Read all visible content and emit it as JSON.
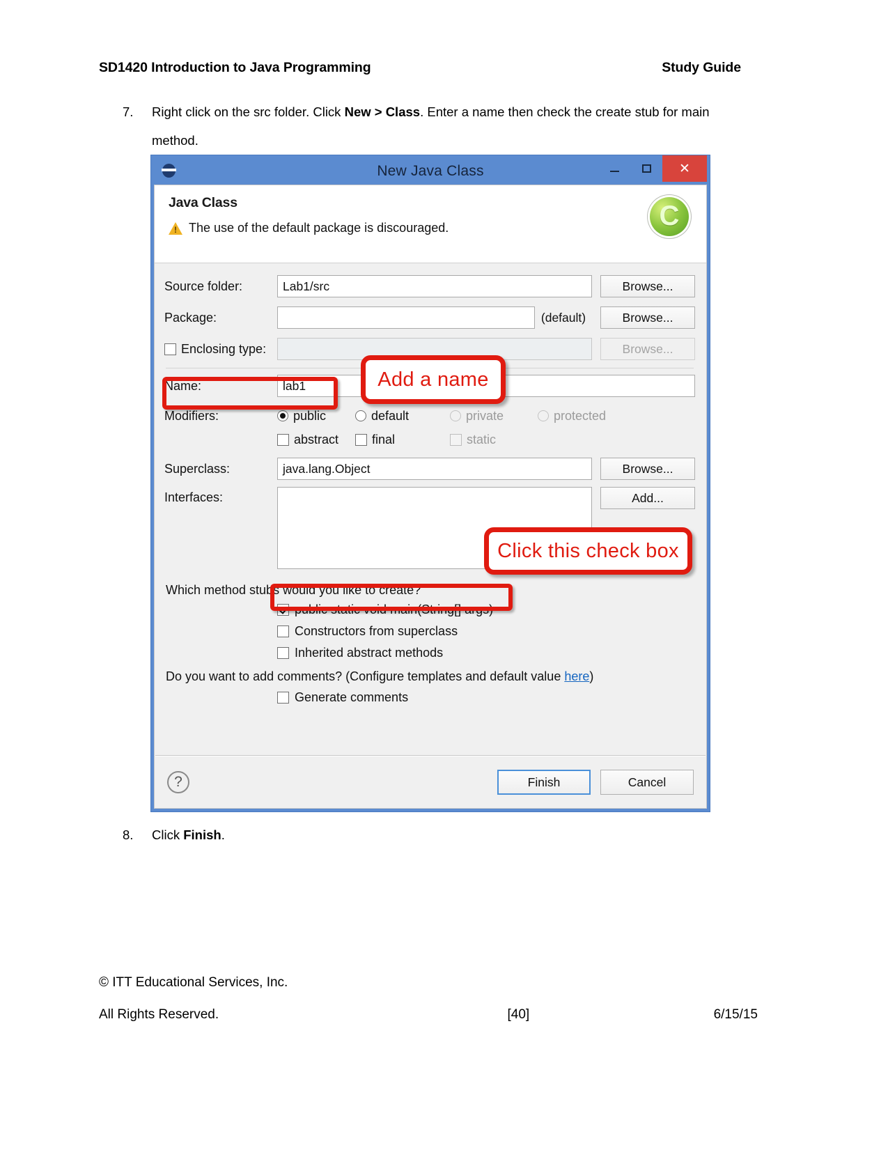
{
  "document": {
    "header_left": "SD1420 Introduction to Java Programming",
    "header_right": "Study Guide",
    "step7": {
      "number": "7.",
      "text_part1": "Right click on the src folder. Click ",
      "bold1": "New > Class",
      "text_part2": ". Enter a name then check the create stub for main method."
    },
    "step8": {
      "number": "8.",
      "text_part1": "Click ",
      "bold1": "Finish",
      "text_part2": "."
    },
    "footer": {
      "copyright": "© ITT Educational Services, Inc.",
      "rights": "All Rights Reserved.",
      "page": "[40]",
      "date": "6/15/15"
    }
  },
  "dialog": {
    "title": "New Java Class",
    "app_icon": "eclipse-globe-icon",
    "window_buttons": {
      "minimize": "minimize-icon",
      "maximize": "maximize-icon",
      "close": "✕"
    },
    "heading": "Java Class",
    "warning_message": "The use of the default package is discouraged.",
    "logo_letter": "C",
    "fields": {
      "source_folder": {
        "label": "Source folder:",
        "value": "Lab1/src",
        "button": "Browse..."
      },
      "package": {
        "label": "Package:",
        "value": "",
        "suffix": "(default)",
        "button": "Browse..."
      },
      "enclosing_type": {
        "label": "Enclosing type:",
        "checked": false,
        "value": "",
        "button": "Browse...",
        "disabled": true
      },
      "name": {
        "label": "Name:",
        "value": "lab1"
      },
      "modifiers": {
        "label": "Modifiers:",
        "radios": [
          {
            "label": "public",
            "selected": true,
            "disabled": false
          },
          {
            "label": "default",
            "selected": false,
            "disabled": false
          },
          {
            "label": "private",
            "selected": false,
            "disabled": true
          },
          {
            "label": "protected",
            "selected": false,
            "disabled": true
          }
        ],
        "checkboxes": [
          {
            "label": "abstract",
            "checked": false,
            "disabled": false
          },
          {
            "label": "final",
            "checked": false,
            "disabled": false
          },
          {
            "label": "static",
            "checked": false,
            "disabled": true
          }
        ]
      },
      "superclass": {
        "label": "Superclass:",
        "value": "java.lang.Object",
        "button": "Browse..."
      },
      "interfaces": {
        "label": "Interfaces:",
        "value": "",
        "button": "Add..."
      }
    },
    "method_stubs": {
      "question": "Which method stubs would you like to create?",
      "options": [
        {
          "label": "public static void main(String[] args)",
          "checked": true
        },
        {
          "label": "Constructors from superclass",
          "checked": false
        },
        {
          "label": "Inherited abstract methods",
          "checked": false
        }
      ]
    },
    "comments": {
      "question_part1": "Do you want to add comments? (Configure templates and default value ",
      "link": "here",
      "question_part2": ")",
      "option": {
        "label": "Generate comments",
        "checked": false
      }
    },
    "buttons": {
      "help": "?",
      "finish": "Finish",
      "cancel": "Cancel"
    }
  },
  "annotations": {
    "add_name": "Add a name",
    "click_check_box": "Click this check box",
    "color": "#e01b10"
  }
}
